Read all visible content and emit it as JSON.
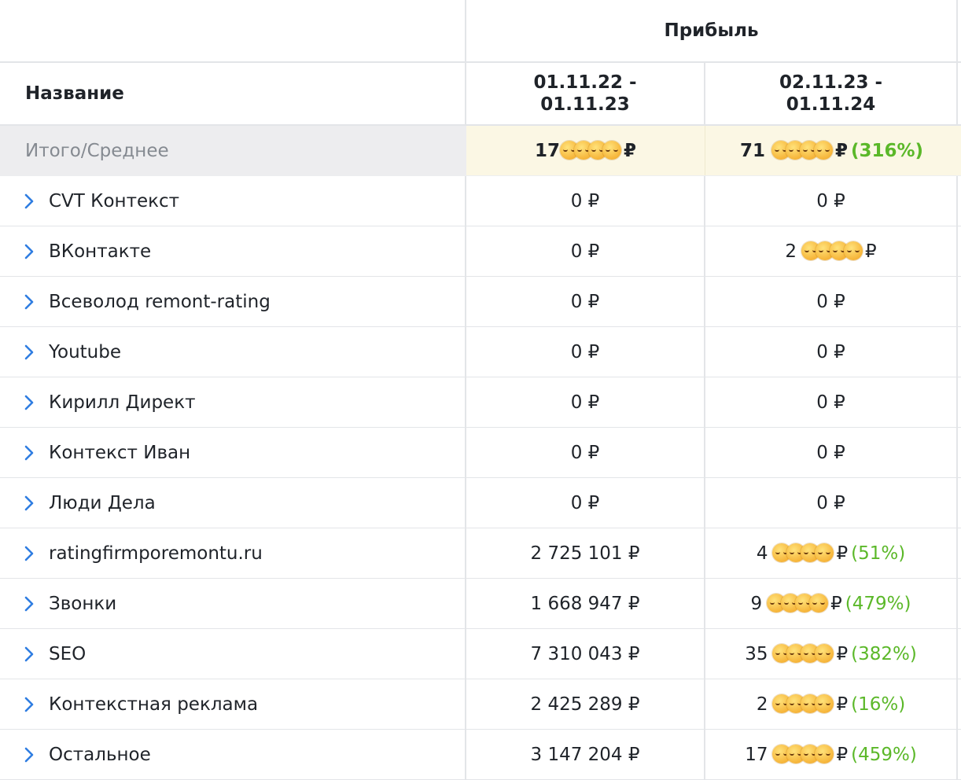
{
  "header": {
    "group_title": "Прибыль",
    "name_col": "Название",
    "period1_line1": "01.11.22 -",
    "period1_line2": "01.11.23",
    "period2_line1": "02.11.23 -",
    "period2_line2": "01.11.24"
  },
  "total": {
    "label": "Итого/Среднее",
    "p1_prefix": "17",
    "p1_suffix": "₽",
    "p2_prefix": "71",
    "p2_suffix": "₽",
    "p2_pct": "(316%)"
  },
  "rows": [
    {
      "name": "CVT Контекст",
      "p1": "0 ₽",
      "p2": "0 ₽"
    },
    {
      "name": "ВКонтакте",
      "p1": "0 ₽",
      "p2_prefix": "2",
      "p2_suffix": "₽"
    },
    {
      "name": "Всеволод remont-rating",
      "p1": "0 ₽",
      "p2": "0 ₽"
    },
    {
      "name": "Youtube",
      "p1": "0 ₽",
      "p2": "0 ₽"
    },
    {
      "name": "Кирилл Директ",
      "p1": "0 ₽",
      "p2": "0 ₽"
    },
    {
      "name": "Контекст Иван",
      "p1": "0 ₽",
      "p2": "0 ₽"
    },
    {
      "name": "Люди Дела",
      "p1": "0 ₽",
      "p2": "0 ₽"
    },
    {
      "name": "ratingfirmporemontu.ru",
      "p1": "2 725 101 ₽",
      "p2_prefix": "4",
      "p2_suffix": "₽",
      "p2_pct": "(51%)"
    },
    {
      "name": "Звонки",
      "p1": "1 668 947 ₽",
      "p2_prefix": "9",
      "p2_suffix": "₽",
      "p2_pct": "(479%)"
    },
    {
      "name": "SEO",
      "p1": "7 310 043 ₽",
      "p2_prefix": "35",
      "p2_suffix": "₽",
      "p2_pct": "(382%)"
    },
    {
      "name": "Контекстная реклама",
      "p1": "2 425 289 ₽",
      "p2_prefix": "2",
      "p2_suffix": "₽",
      "p2_pct": "(16%)"
    },
    {
      "name": "Остальное",
      "p1": "3 147 204 ₽",
      "p2_prefix": "17",
      "p2_suffix": "₽",
      "p2_pct": "(459%)"
    }
  ],
  "colors": {
    "positive_pct": "#5bb829",
    "chevron": "#2f7de1",
    "total_highlight": "#fbf7e4"
  },
  "icons": {
    "expand": "chevron-right-icon",
    "mask": "relieved-face-emoji"
  }
}
